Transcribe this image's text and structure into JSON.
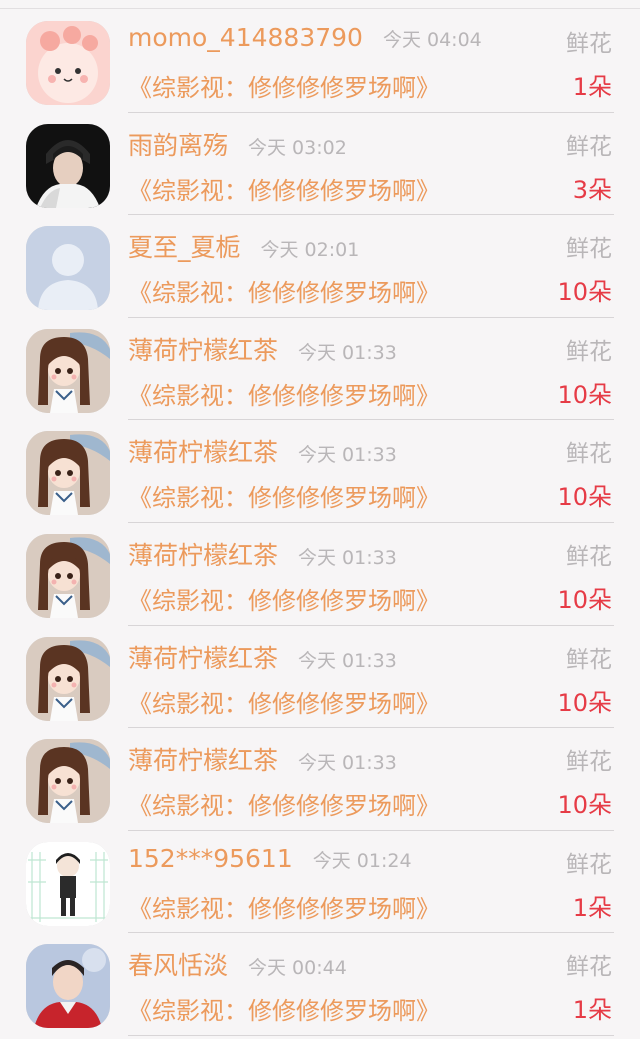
{
  "gift_list": [
    {
      "avatar_icon": "pink-cartoon-avatar-icon",
      "name": "momo_414883790",
      "time": "今天 04:04",
      "gift_type": "鲜花",
      "book": "《综影视：修修修修罗场啊》",
      "count": "1朵"
    },
    {
      "avatar_icon": "man-portrait-avatar-icon",
      "name": "雨韵离殇",
      "time": "今天 03:02",
      "gift_type": "鲜花",
      "book": "《综影视：修修修修罗场啊》",
      "count": "3朵"
    },
    {
      "avatar_icon": "default-user-avatar-icon",
      "name": "夏至_夏栀",
      "time": "今天 02:01",
      "gift_type": "鲜花",
      "book": "《综影视：修修修修罗场啊》",
      "count": "10朵"
    },
    {
      "avatar_icon": "anime-girl-avatar-icon",
      "name": "薄荷柠檬红茶",
      "time": "今天 01:33",
      "gift_type": "鲜花",
      "book": "《综影视：修修修修罗场啊》",
      "count": "10朵"
    },
    {
      "avatar_icon": "anime-girl-avatar-icon",
      "name": "薄荷柠檬红茶",
      "time": "今天 01:33",
      "gift_type": "鲜花",
      "book": "《综影视：修修修修罗场啊》",
      "count": "10朵"
    },
    {
      "avatar_icon": "anime-girl-avatar-icon",
      "name": "薄荷柠檬红茶",
      "time": "今天 01:33",
      "gift_type": "鲜花",
      "book": "《综影视：修修修修罗场啊》",
      "count": "10朵"
    },
    {
      "avatar_icon": "anime-girl-avatar-icon",
      "name": "薄荷柠檬红茶",
      "time": "今天 01:33",
      "gift_type": "鲜花",
      "book": "《综影视：修修修修罗场啊》",
      "count": "10朵"
    },
    {
      "avatar_icon": "anime-girl-avatar-icon",
      "name": "薄荷柠檬红茶",
      "time": "今天 01:33",
      "gift_type": "鲜花",
      "book": "《综影视：修修修修罗场啊》",
      "count": "10朵"
    },
    {
      "avatar_icon": "chibi-figure-avatar-icon",
      "name": "152***95611",
      "time": "今天 01:24",
      "gift_type": "鲜花",
      "book": "《综影视：修修修修罗场啊》",
      "count": "1朵"
    },
    {
      "avatar_icon": "young-man-photo-avatar-icon",
      "name": "春风恬淡",
      "time": "今天 00:44",
      "gift_type": "鲜花",
      "book": "《综影视：修修修修罗场啊》",
      "count": "1朵"
    }
  ],
  "colors": {
    "accent_orange": "#ec9a5c",
    "count_red": "#e63b46",
    "muted_gray": "#b9b6b8",
    "background": "#f7f5f6"
  }
}
